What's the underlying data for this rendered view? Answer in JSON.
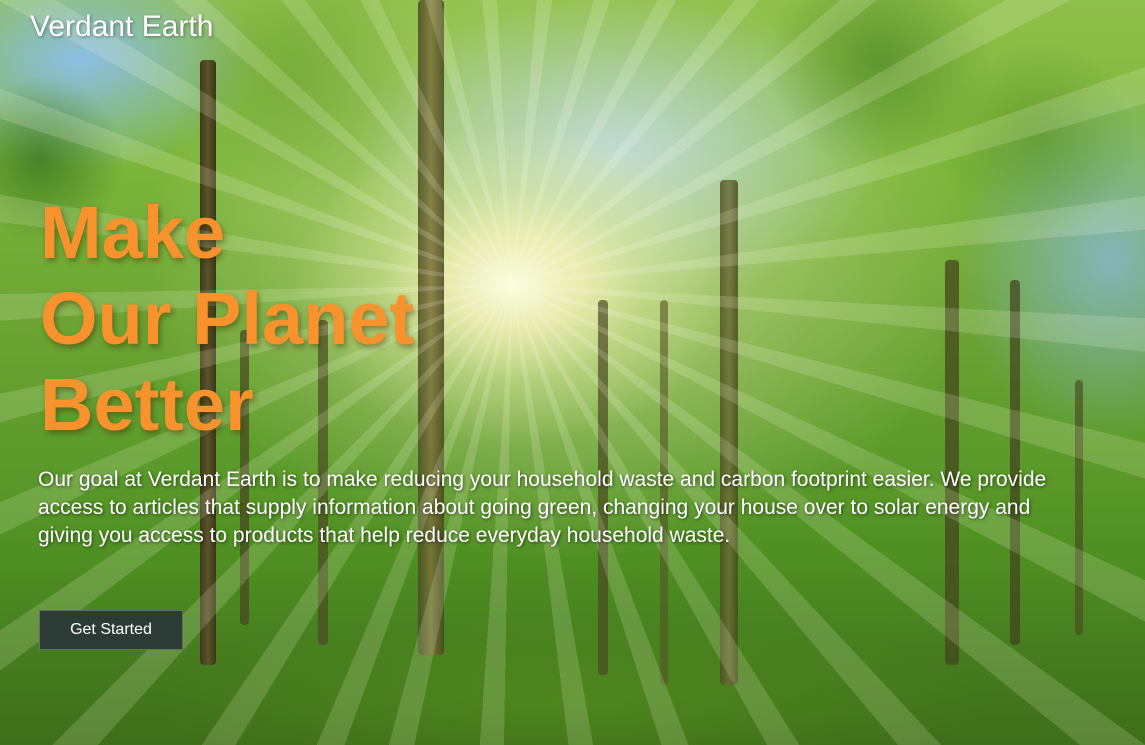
{
  "header": {
    "site_title": "Verdant Earth"
  },
  "hero": {
    "headline_lines": [
      "Make",
      "Our Planet",
      "Better"
    ],
    "description": "Our goal at Verdant Earth is to make reducing your household waste and carbon footprint easier. We provide access to articles that supply information about going green, changing your house over to solar energy and giving you access to products that help reduce everyday household waste.",
    "cta_label": "Get Started",
    "background_image": "sunlit-forest-photo"
  },
  "colors": {
    "headline": "#f7922c",
    "button_bg": "#2c3b35",
    "text": "#ffffff"
  }
}
